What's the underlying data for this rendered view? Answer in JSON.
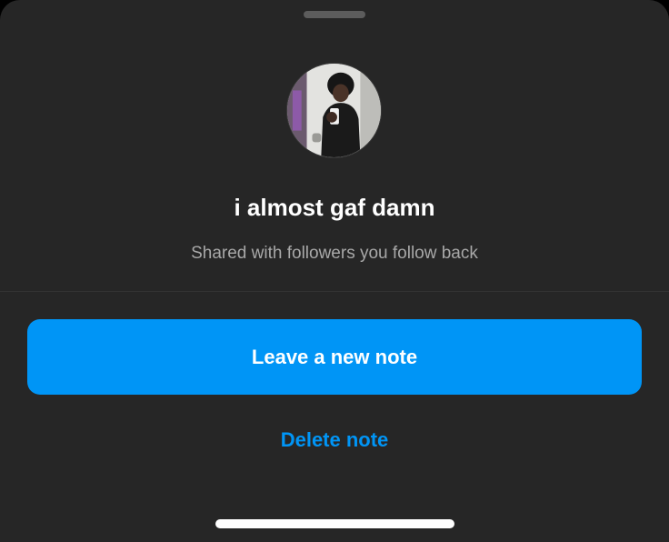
{
  "note": {
    "text": "i almost gaf damn",
    "audience": "Shared with followers you follow back"
  },
  "actions": {
    "primary_label": "Leave a new note",
    "secondary_label": "Delete note"
  },
  "colors": {
    "sheet_background": "#262626",
    "accent": "#0095f6",
    "secondary_text": "#a8a8a8"
  },
  "icons": {
    "avatar": "profile-photo"
  }
}
